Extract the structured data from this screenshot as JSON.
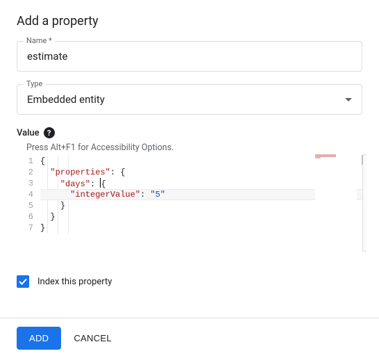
{
  "dialog": {
    "title": "Add a property"
  },
  "fields": {
    "name": {
      "label": "Name *",
      "value": "estimate"
    },
    "type": {
      "label": "Type",
      "value": "Embedded entity"
    }
  },
  "valueSection": {
    "label": "Value",
    "accessibilityHint": "Press Alt+F1 for Accessibility Options."
  },
  "jsonEditor": {
    "lineNumbers": [
      "1",
      "2",
      "3",
      "4",
      "5",
      "6",
      "7"
    ],
    "currentLine": 4,
    "tokens": {
      "key_properties": "\"properties\"",
      "key_days": "\"days\"",
      "key_integerValue": "\"integerValue\"",
      "val_5": "\"5\""
    },
    "raw": "{\n  \"properties\": {\n    \"days\": {\n      \"integerValue\": \"5\"\n    }\n  }\n}"
  },
  "index": {
    "checked": true,
    "label": "Index this property"
  },
  "buttons": {
    "add": "ADD",
    "cancel": "CANCEL"
  }
}
